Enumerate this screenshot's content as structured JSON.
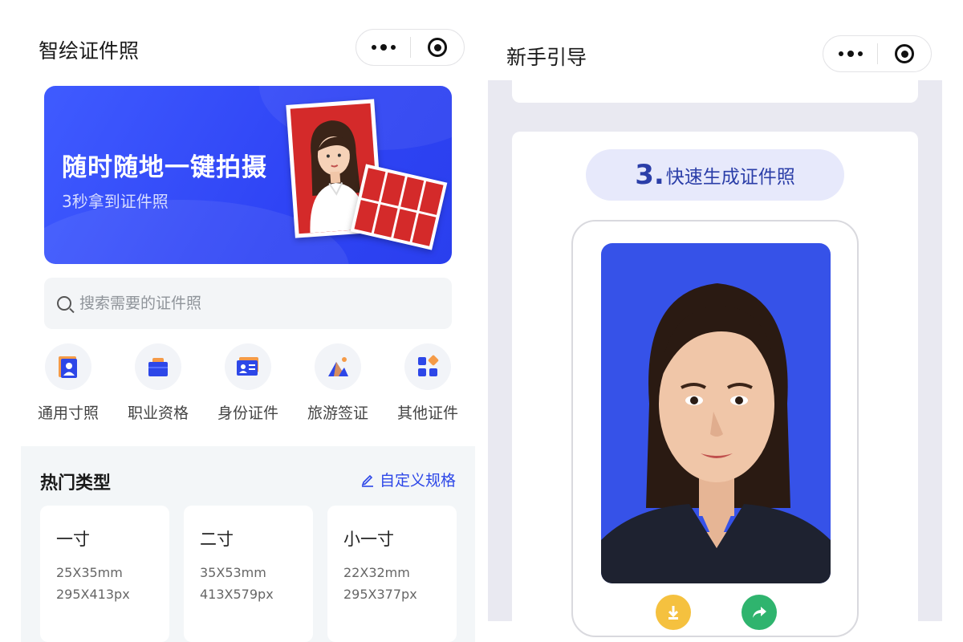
{
  "left_screen": {
    "app_title": "智绘证件照",
    "banner": {
      "title": "随时随地一键拍摄",
      "subtitle": "3秒拿到证件照"
    },
    "search": {
      "placeholder": "搜索需要的证件照"
    },
    "categories": [
      {
        "label": "通用寸照",
        "icon": "portrait-photo-icon"
      },
      {
        "label": "职业资格",
        "icon": "briefcase-icon"
      },
      {
        "label": "身份证件",
        "icon": "id-card-icon"
      },
      {
        "label": "旅游签证",
        "icon": "mountain-icon"
      },
      {
        "label": "其他证件",
        "icon": "apps-icon"
      }
    ],
    "hot_section": {
      "title": "热门类型",
      "custom_label": "自定义规格",
      "cards": [
        {
          "name": "一寸",
          "mm": "25X35mm",
          "px": "295X413px"
        },
        {
          "name": "二寸",
          "mm": "35X53mm",
          "px": "413X579px"
        },
        {
          "name": "小一寸",
          "mm": "22X32mm",
          "px": "295X377px"
        }
      ]
    }
  },
  "right_screen": {
    "title": "新手引导",
    "step": {
      "number": "3.",
      "text": "快速生成证件照"
    },
    "actions": [
      {
        "icon": "download-icon",
        "color": "#f5c13f"
      },
      {
        "icon": "share-icon",
        "color": "#2fb46e"
      }
    ]
  },
  "colors": {
    "brand_blue": "#2f44f5",
    "portrait_bg": "#3652e8",
    "photo_red": "#d42a2a",
    "accent_text": "#2d47e8"
  }
}
